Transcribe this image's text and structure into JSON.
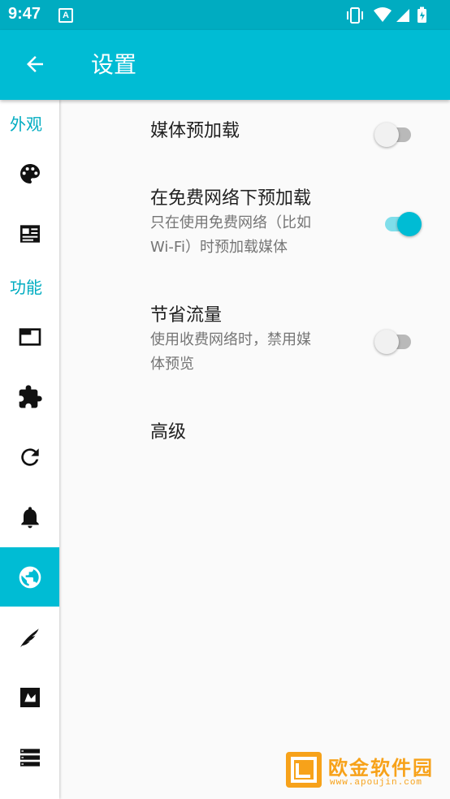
{
  "status_bar": {
    "time": "9:47",
    "notification_icon": "A"
  },
  "app_bar": {
    "title": "设置",
    "back_icon": "arrow-left-icon"
  },
  "sidebar": {
    "section_appearance": "外观",
    "section_features": "功能",
    "items": [
      {
        "icon": "palette-icon"
      },
      {
        "icon": "article-icon"
      },
      {
        "icon": "tab-icon"
      },
      {
        "icon": "extension-icon"
      },
      {
        "icon": "refresh-icon"
      },
      {
        "icon": "bell-icon"
      },
      {
        "icon": "globe-icon",
        "selected": true
      },
      {
        "icon": "feather-icon"
      },
      {
        "icon": "image-icon"
      },
      {
        "icon": "storage-icon"
      }
    ]
  },
  "prefs": [
    {
      "title": "媒体预加载",
      "summary": "",
      "checked": false
    },
    {
      "title": "在免费网络下预加载",
      "summary_line1": "只在使用免费网络（比如",
      "summary_line2": "Wi-Fi）时预加载媒体",
      "checked": true
    },
    {
      "title": "节省流量",
      "summary_line1": "使用收费网络时，禁用媒",
      "summary_line2": "体预览",
      "checked": false
    },
    {
      "title": "高级"
    }
  ],
  "watermark": {
    "text": "欧金软件园",
    "url": "www.apoujin.com"
  },
  "colors": {
    "primary": "#00bcd4",
    "primary_dark": "#00acc1",
    "accent": "#00bcd4"
  }
}
